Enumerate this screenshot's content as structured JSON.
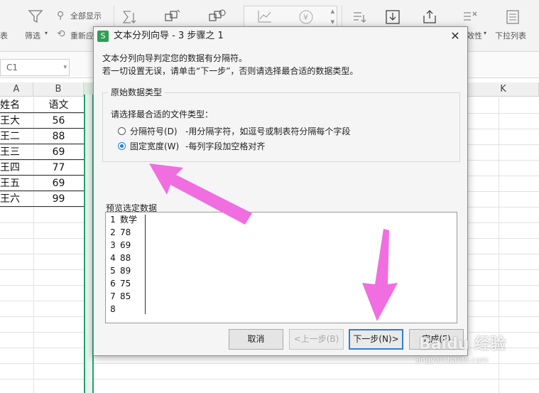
{
  "ribbon": {
    "items": [
      {
        "label": "表",
        "icon": "table-icon"
      },
      {
        "label": "筛选",
        "icon": "filter-icon"
      },
      {
        "label": "全部显示",
        "icon": "show-all-icon"
      },
      {
        "label": "重新应",
        "icon": "reapply-icon"
      },
      {
        "label": "效性",
        "icon": "validity-icon"
      },
      {
        "label": "下拉列表",
        "icon": "dropdown-list-icon"
      }
    ]
  },
  "formula_bar": {
    "name_box": "C1"
  },
  "sheet": {
    "columns": [
      "A",
      "B",
      "K"
    ],
    "rows": [
      {
        "a": "姓名",
        "b": "语文"
      },
      {
        "a": "王大",
        "b": "56"
      },
      {
        "a": "王二",
        "b": "88"
      },
      {
        "a": "王三",
        "b": "69"
      },
      {
        "a": "王四",
        "b": "77"
      },
      {
        "a": "王五",
        "b": "69"
      },
      {
        "a": "王六",
        "b": "99"
      }
    ]
  },
  "dialog": {
    "icon_letter": "S",
    "title": "文本分列向导 - 3 步骤之 1",
    "close": "✕",
    "desc1": "文本分列向导判定您的数据有分隔符。",
    "desc2": "若一切设置无误，请单击“下一步”，否则请选择最合适的数据类型。",
    "group_title": "原始数据类型",
    "prompt": "请选择最合适的文件类型：",
    "option1": {
      "label": "分隔符号(D)",
      "desc": "-用分隔字符，如逗号或制表符分隔每个字段",
      "selected": false
    },
    "option2": {
      "label": "固定宽度(W)",
      "desc": "-每列字段加空格对齐",
      "selected": true
    },
    "preview_label": "预览选定数据",
    "preview_rows": [
      {
        "n": "1",
        "v": "数学"
      },
      {
        "n": "2",
        "v": "78"
      },
      {
        "n": "3",
        "v": "69"
      },
      {
        "n": "4",
        "v": "88"
      },
      {
        "n": "5",
        "v": "89"
      },
      {
        "n": "6",
        "v": "75"
      },
      {
        "n": "7",
        "v": "85"
      },
      {
        "n": "8",
        "v": ""
      }
    ],
    "buttons": {
      "cancel": "取消",
      "back": "<上一步(B)",
      "next": "下一步(N)>",
      "finish": "完成(F)"
    }
  },
  "watermark": {
    "brand": "Baidu 经验",
    "url": "jingyan.baidu.com"
  },
  "colors": {
    "accent": "#21a366",
    "arrow": "#f06ee0",
    "default_button": "#2f7fd8"
  }
}
